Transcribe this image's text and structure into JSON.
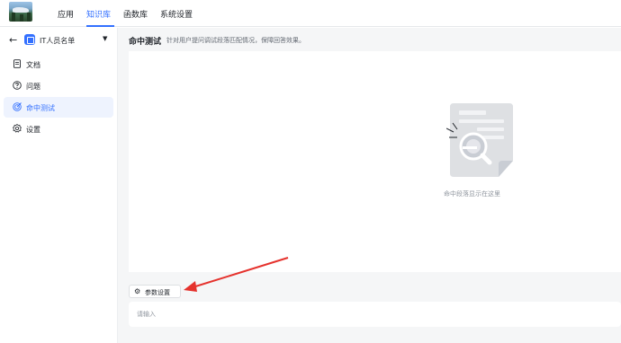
{
  "topnav": {
    "items": [
      "应用",
      "知识库",
      "函数库",
      "系统设置"
    ],
    "active_index": 1
  },
  "sidebar": {
    "knowledge_base_name": "IT人员名单",
    "items": [
      {
        "label": "文档",
        "icon": "document-icon"
      },
      {
        "label": "问题",
        "icon": "question-icon"
      },
      {
        "label": "命中测试",
        "icon": "target-icon"
      },
      {
        "label": "设置",
        "icon": "gear-icon"
      }
    ],
    "active_index": 2
  },
  "main": {
    "title": "命中测试",
    "description": "针对用户提问调试段落匹配情况，保障回答效果。",
    "empty_text": "命中段落显示在这里",
    "param_button_label": "参数设置",
    "input_placeholder": "请输入"
  },
  "colors": {
    "accent": "#3370ff",
    "annotation": "#e5322d"
  }
}
